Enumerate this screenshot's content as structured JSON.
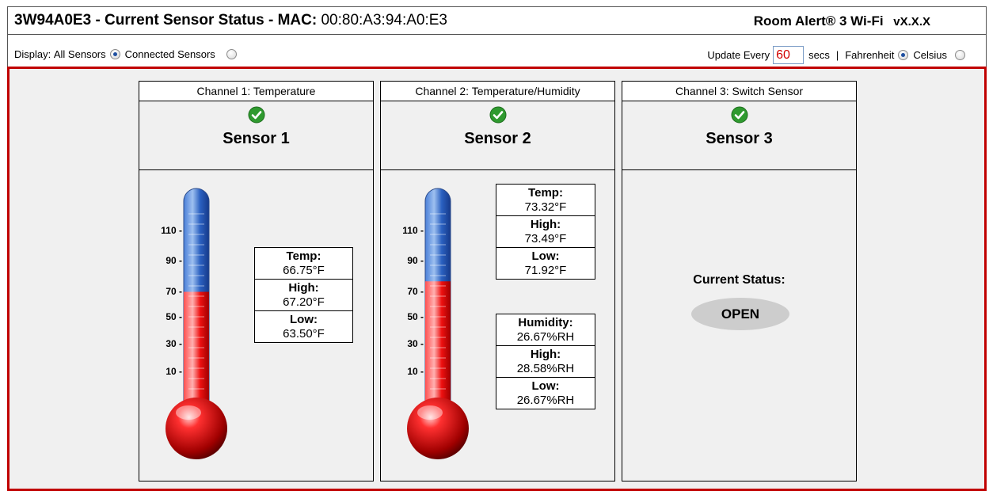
{
  "header": {
    "title_prefix": "3W94A0E3 - Current Sensor Status - MAC:",
    "mac": "00:80:A3:94:A0:E3",
    "product": "Room Alert® 3 Wi-Fi",
    "version": "vX.X.X"
  },
  "controls": {
    "display_label": "Display:",
    "all_sensors_label": "All Sensors",
    "connected_sensors_label": "Connected Sensors",
    "update_every_label": "Update Every",
    "update_seconds": "60",
    "secs_label": "secs",
    "separator": "|",
    "fahrenheit_label": "Fahrenheit",
    "celsius_label": "Celsius",
    "display_mode_selected": "All Sensors",
    "units_selected": "Fahrenheit"
  },
  "colors": {
    "accent_border": "#c00000",
    "ok_check": "#2f9a2f",
    "mercury": "#e00000",
    "tube_blue": "#1f56b4"
  },
  "icons": {
    "status_ok": "check-circle-icon",
    "thermometer": "thermometer-icon"
  },
  "scale_ticks": [
    "110 -",
    "90 -",
    "70 -",
    "50 -",
    "30 -",
    "10 -"
  ],
  "sensors": [
    {
      "channel": "Channel 1: Temperature",
      "name": "Sensor 1",
      "thermometer_fill": 0.5,
      "temp": {
        "label": "Temp:",
        "value": "66.75°F"
      },
      "high": {
        "label": "High:",
        "value": "67.20°F"
      },
      "low": {
        "label": "Low:",
        "value": "63.50°F"
      }
    },
    {
      "channel": "Channel 2: Temperature/Humidity",
      "name": "Sensor 2",
      "thermometer_fill": 0.55,
      "temp": {
        "label": "Temp:",
        "value": "73.32°F"
      },
      "high": {
        "label": "High:",
        "value": "73.49°F"
      },
      "low": {
        "label": "Low:",
        "value": "71.92°F"
      },
      "humidity": {
        "label": "Humidity:",
        "value": "26.67%RH"
      },
      "hum_high": {
        "label": "High:",
        "value": "28.58%RH"
      },
      "hum_low": {
        "label": "Low:",
        "value": "26.67%RH"
      }
    },
    {
      "channel": "Channel 3: Switch Sensor",
      "name": "Sensor 3",
      "status_label": "Current Status:",
      "status_value": "OPEN"
    }
  ]
}
